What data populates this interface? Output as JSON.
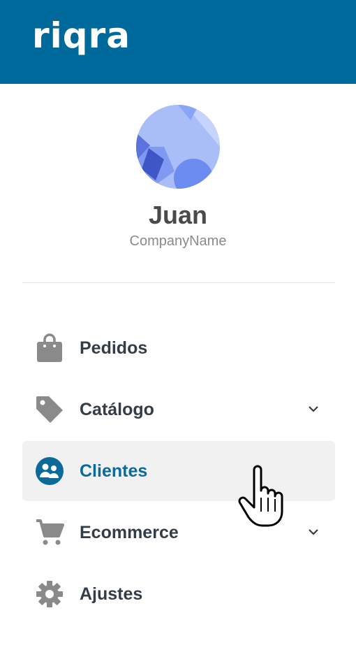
{
  "header": {
    "logo_text": "riqra",
    "background": "#00699b"
  },
  "profile": {
    "name": "Juan",
    "company": "CompanyName"
  },
  "nav": {
    "items": [
      {
        "label": "Pedidos",
        "icon": "shopping-bag-icon",
        "expandable": false,
        "active": false
      },
      {
        "label": "Catálogo",
        "icon": "tag-icon",
        "expandable": true,
        "active": false
      },
      {
        "label": "Clientes",
        "icon": "customers-icon",
        "expandable": false,
        "active": true
      },
      {
        "label": "Ecommerce",
        "icon": "shopping-cart-icon",
        "expandable": true,
        "active": false
      },
      {
        "label": "Ajustes",
        "icon": "gear-icon",
        "expandable": false,
        "active": false
      }
    ],
    "active_color": "#0b6a99",
    "text_color": "#333d47",
    "icon_color": "#8a8a8a"
  },
  "cursor": {
    "icon": "hand-pointer-icon"
  }
}
